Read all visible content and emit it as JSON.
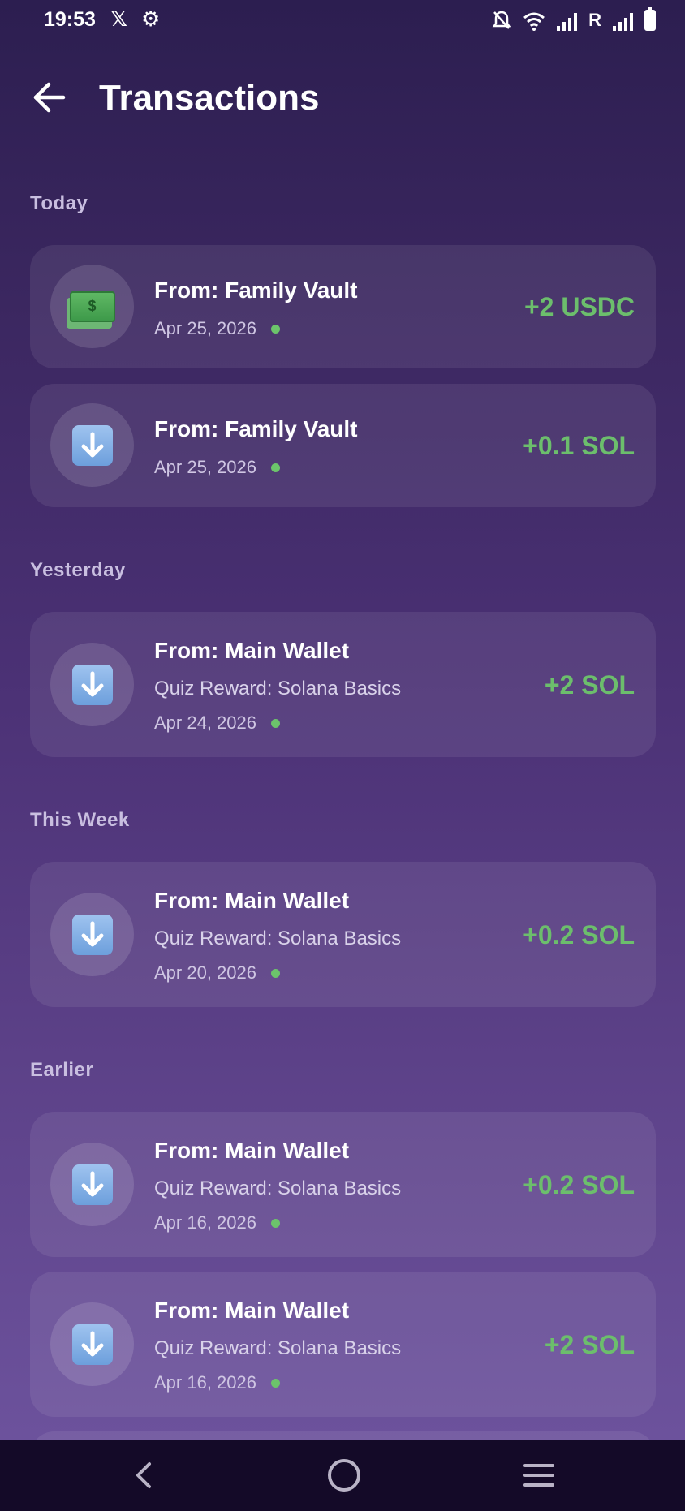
{
  "status_bar": {
    "time": "19:53",
    "carrier_letter": "R"
  },
  "header": {
    "title": "Transactions"
  },
  "sections": [
    {
      "label": "Today"
    },
    {
      "label": "Yesterday"
    },
    {
      "label": "This Week"
    },
    {
      "label": "Earlier"
    }
  ],
  "transactions": [
    {
      "icon": "cash-icon",
      "from": "From: Family Vault",
      "memo": "",
      "date": "Apr 25, 2026",
      "amount": "+2 USDC"
    },
    {
      "icon": "down-arrow-icon",
      "from": "From: Family Vault",
      "memo": "",
      "date": "Apr 25, 2026",
      "amount": "+0.1 SOL"
    },
    {
      "icon": "down-arrow-icon",
      "from": "From: Main Wallet",
      "memo": "Quiz Reward: Solana Basics",
      "date": "Apr 24, 2026",
      "amount": "+2 SOL"
    },
    {
      "icon": "down-arrow-icon",
      "from": "From: Main Wallet",
      "memo": "Quiz Reward: Solana Basics",
      "date": "Apr 20, 2026",
      "amount": "+0.2 SOL"
    },
    {
      "icon": "down-arrow-icon",
      "from": "From: Main Wallet",
      "memo": "Quiz Reward: Solana Basics",
      "date": "Apr 16, 2026",
      "amount": "+0.2 SOL"
    },
    {
      "icon": "down-arrow-icon",
      "from": "From: Main Wallet",
      "memo": "Quiz Reward: Solana Basics",
      "date": "Apr 16, 2026",
      "amount": "+2 SOL"
    }
  ],
  "colors": {
    "amount_positive": "#6cbe6c",
    "status_dot": "#6cc46b",
    "background_top": "#2c1e50",
    "background_bottom": "#6f55a0"
  }
}
